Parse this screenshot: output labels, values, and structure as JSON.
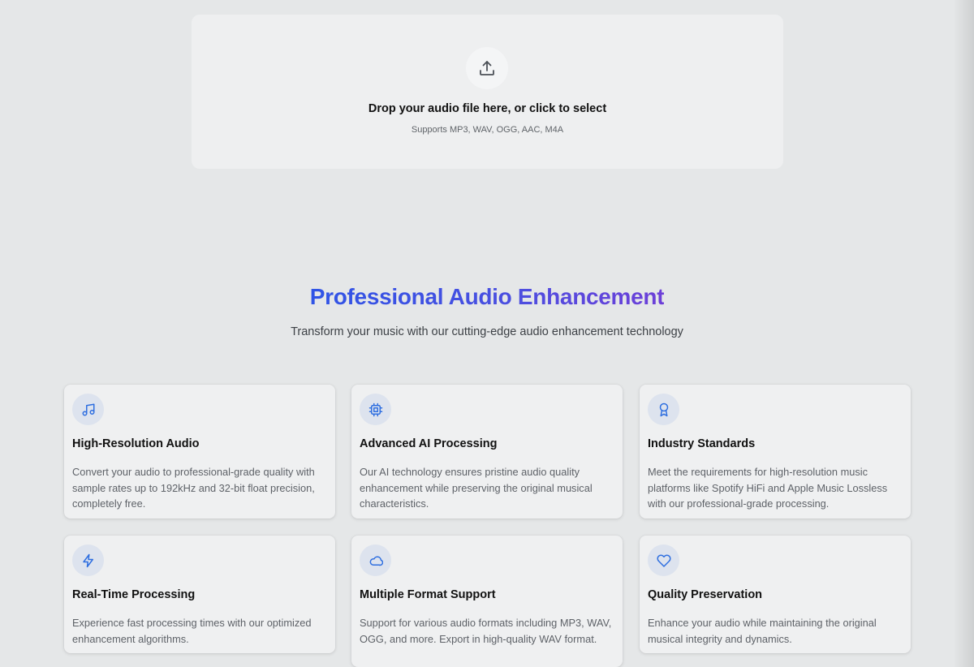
{
  "upload": {
    "title": "Drop your audio file here, or click to select",
    "subtitle": "Supports MP3, WAV, OGG, AAC, M4A",
    "icon": "upload-icon"
  },
  "hero": {
    "title": "Professional Audio Enhancement",
    "subtitle": "Transform your music with our cutting-edge audio enhancement technology"
  },
  "colors": {
    "accent": "#2f54e6",
    "accent_end": "#6d3fd8",
    "icon_stroke": "#2f6fe0"
  },
  "features": [
    {
      "icon": "music-note-icon",
      "title": "High-Resolution Audio",
      "description": "Convert your audio to professional-grade quality with sample rates up to 192kHz and 32-bit float precision, completely free."
    },
    {
      "icon": "cpu-chip-icon",
      "title": "Advanced AI Processing",
      "description": "Our AI technology ensures pristine audio quality enhancement while preserving the original musical characteristics."
    },
    {
      "icon": "award-badge-icon",
      "title": "Industry Standards",
      "description": "Meet the requirements for high-resolution music platforms like Spotify HiFi and Apple Music Lossless with our professional-grade processing."
    },
    {
      "icon": "lightning-bolt-icon",
      "title": "Real-Time Processing",
      "description": "Experience fast processing times with our optimized enhancement algorithms."
    },
    {
      "icon": "cloud-icon",
      "title": "Multiple Format Support",
      "description": "Support for various audio formats including MP3, WAV, OGG, and more. Export in high-quality WAV format."
    },
    {
      "icon": "heart-icon",
      "title": "Quality Preservation",
      "description": "Enhance your audio while maintaining the original musical integrity and dynamics."
    }
  ]
}
